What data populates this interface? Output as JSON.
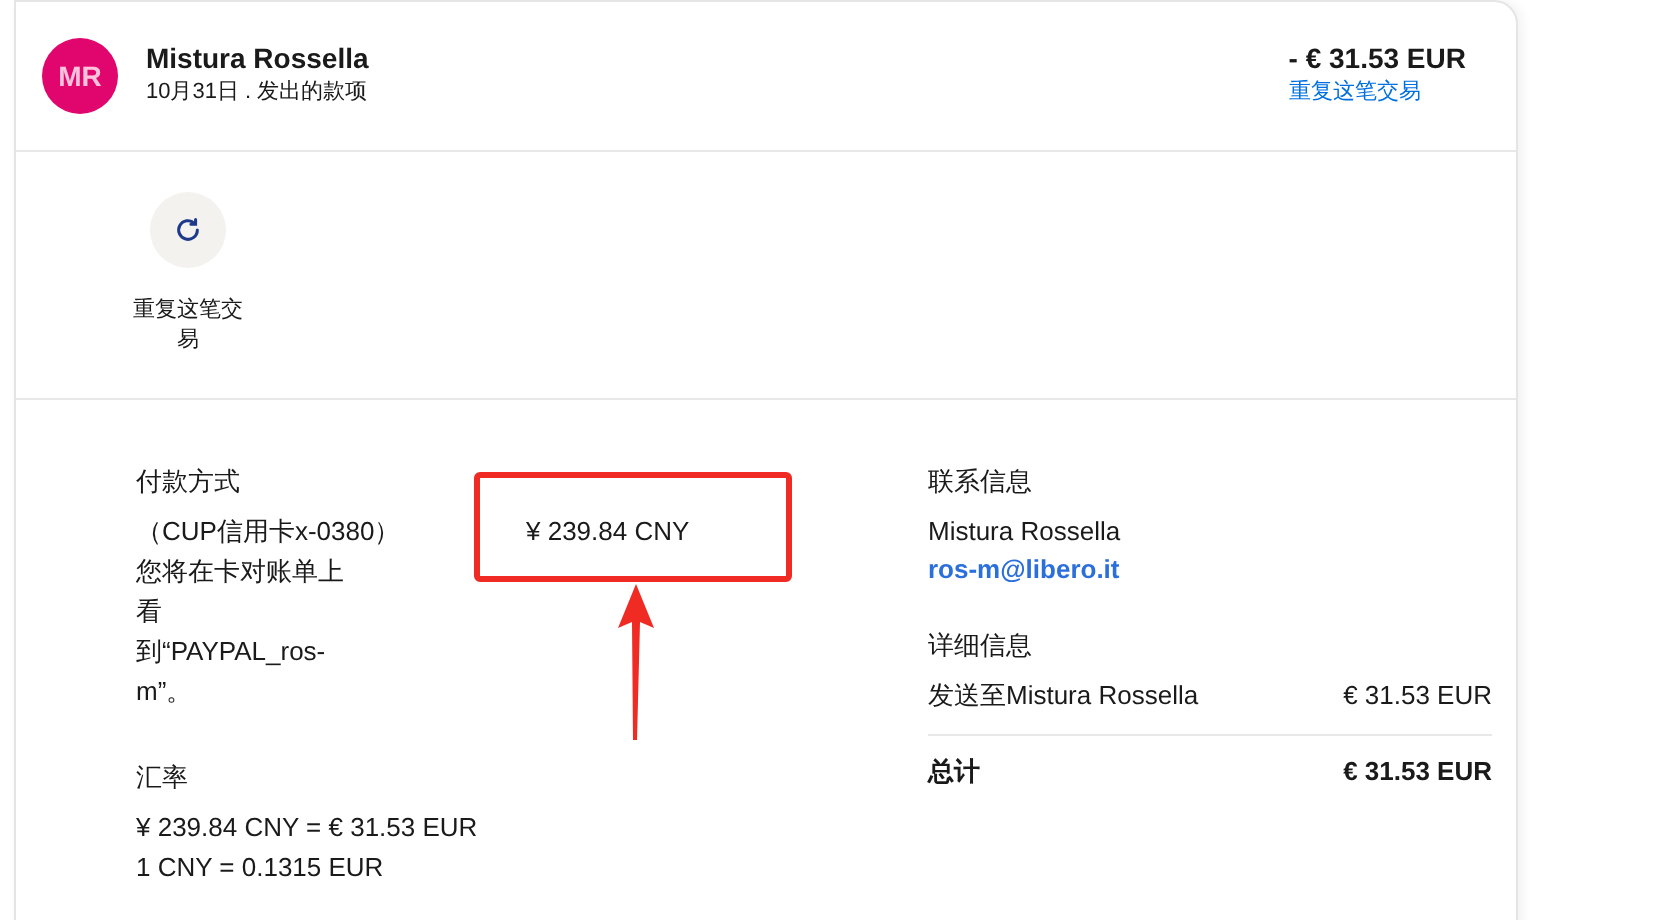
{
  "header": {
    "avatar_initials": "MR",
    "name": "Mistura Rossella",
    "subtitle": "10月31日 . 发出的款项",
    "amount": "- € 31.53 EUR",
    "repeat_link": "重复这笔交易"
  },
  "actions": [
    {
      "kind": "repeat",
      "label": "重复这笔交易"
    }
  ],
  "payment": {
    "title": "付款方式",
    "card": "（CUP信用卡x-0380）",
    "note": "您将在卡对账单上看到“PAYPAL_ros-m”。",
    "amount": "¥ 239.84 CNY"
  },
  "exchange": {
    "title": "汇率",
    "lines": [
      "¥ 239.84 CNY = € 31.53 EUR",
      "1 CNY = 0.1315 EUR"
    ]
  },
  "contact": {
    "title": "联系信息",
    "name": "Mistura Rossella",
    "email": "ros-m@libero.it"
  },
  "details": {
    "title": "详细信息",
    "rows": [
      {
        "kind": "item",
        "label": "发送至Mistura Rossella",
        "value": "€ 31.53 EUR"
      },
      {
        "kind": "total",
        "label": "总计",
        "value": "€ 31.53 EUR"
      }
    ]
  }
}
